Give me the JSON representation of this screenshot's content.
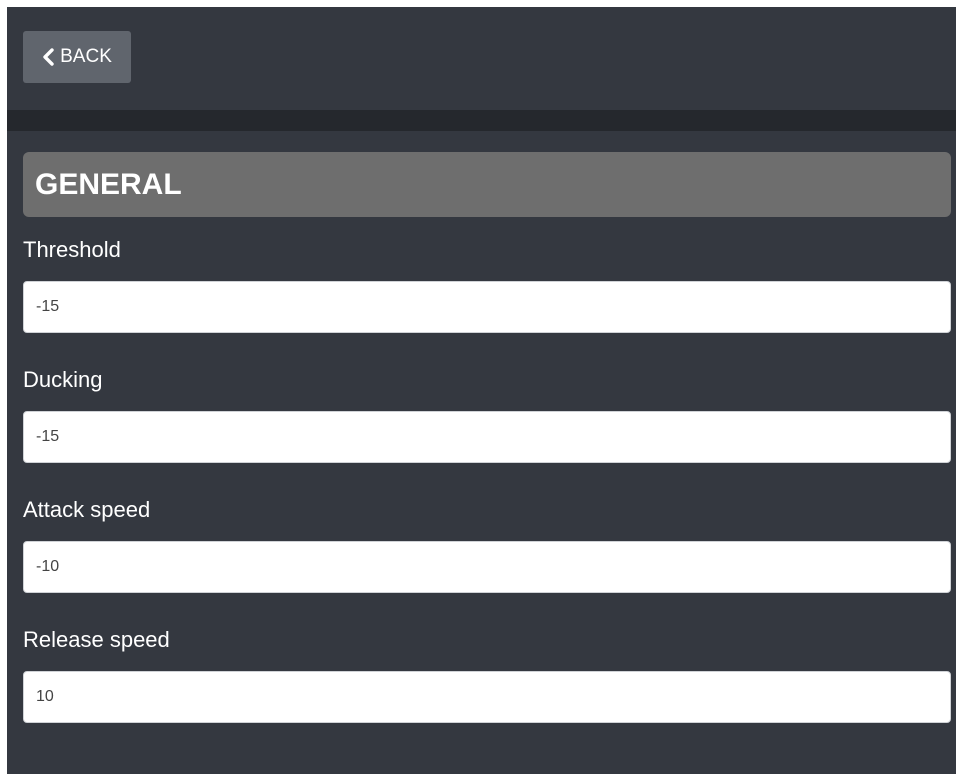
{
  "toolbar": {
    "back_label": "BACK"
  },
  "section": {
    "title": "GENERAL"
  },
  "fields": [
    {
      "label": "Threshold",
      "value": "-15"
    },
    {
      "label": "Ducking",
      "value": "-15"
    },
    {
      "label": "Attack speed",
      "value": "-10"
    },
    {
      "label": "Release speed",
      "value": "10"
    }
  ],
  "colors": {
    "panel_bg": "#343840",
    "divider": "#25282d",
    "button_bg": "#60656d",
    "section_header_bg": "#6e6e6e",
    "input_bg": "#ffffff"
  }
}
